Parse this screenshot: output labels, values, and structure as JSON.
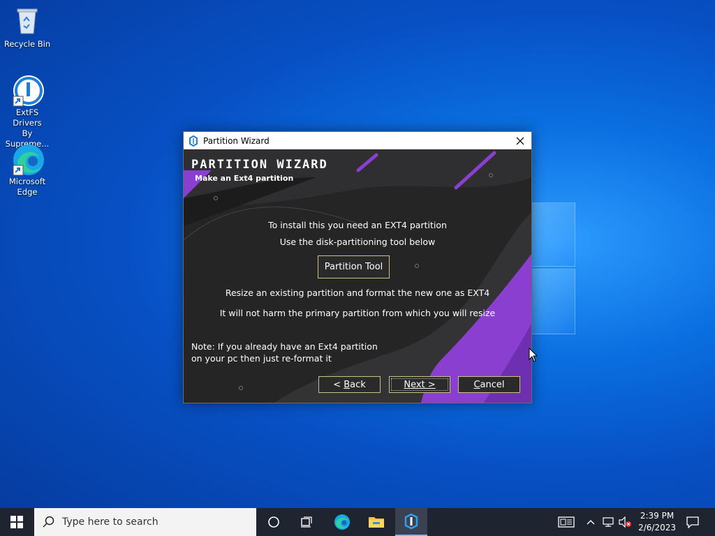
{
  "desktop": {
    "icons": [
      {
        "label": "Recycle Bin"
      },
      {
        "label_line1": "ExtFS Drivers",
        "label_line2": "By Supreme..."
      },
      {
        "label_line1": "Microsoft",
        "label_line2": "Edge"
      }
    ]
  },
  "dialog": {
    "title": "Partition Wizard",
    "header_title": "PARTITION WIZARD",
    "header_subtitle": "Make an Ext4 partition",
    "line1": "To install this you need an EXT4 partition",
    "line2": "Use the disk-partitioning tool below",
    "partition_tool_label": "Partition Tool",
    "line3": "Resize an existing partition and format the new one as EXT4",
    "line4": "It will not harm the primary partition from which you will resize",
    "note_line1": "Note: If you already have an Ext4 partition",
    "note_line2": "on your pc then just re-format it",
    "back_prefix": "< ",
    "back_mnemonic": "B",
    "back_rest": "ack",
    "next_mnemonic": "N",
    "next_rest": "ext >",
    "cancel_mnemonic": "C",
    "cancel_rest": "ancel"
  },
  "taskbar": {
    "search_placeholder": "Type here to search",
    "time": "2:39 PM",
    "date": "2/6/2023"
  },
  "colors": {
    "accent_purple": "#8a3fd0",
    "dialog_bg": "#252526",
    "button_border": "#c9c28c",
    "taskbar_bg": "#1f2530"
  }
}
